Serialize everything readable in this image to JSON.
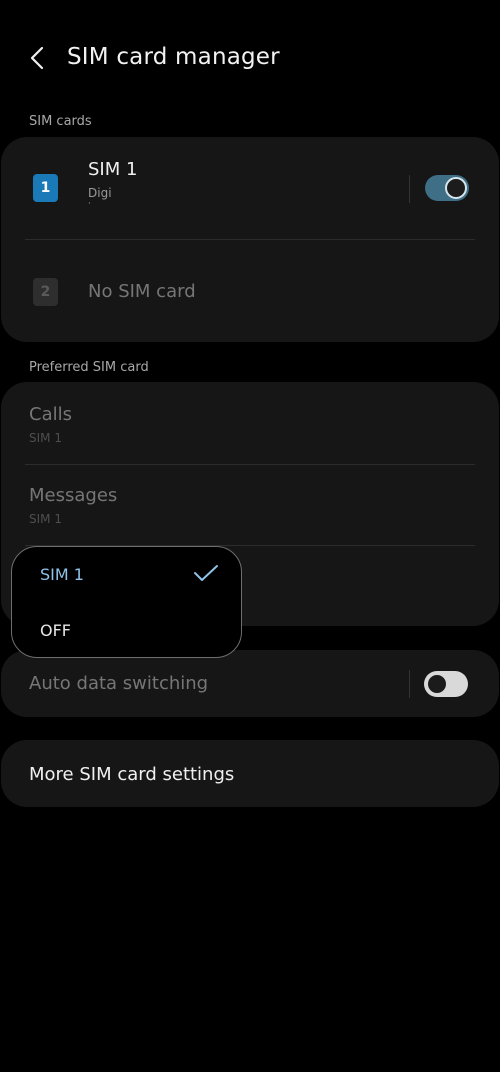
{
  "header": {
    "title": "SIM card manager"
  },
  "sections": {
    "sim_cards_label": "SIM cards",
    "preferred_label": "Preferred SIM card"
  },
  "sim_cards": [
    {
      "badge": "1",
      "name": "SIM 1",
      "carrier": "Digi",
      "carrier_sub": "·",
      "enabled": true
    },
    {
      "badge": "2",
      "name": "No SIM card"
    }
  ],
  "preferred": {
    "calls": {
      "label": "Calls",
      "value": "SIM 1"
    },
    "messages": {
      "label": "Messages",
      "value": "SIM 1"
    }
  },
  "popup": {
    "options": [
      "SIM 1",
      "OFF"
    ],
    "selected": "SIM 1"
  },
  "auto_data_switching": {
    "label": "Auto data switching",
    "enabled": false
  },
  "more_settings": {
    "label": "More SIM card settings"
  },
  "colors": {
    "accent": "#1a7ab8",
    "selected_text": "#8fc3e8",
    "background": "#000000",
    "card": "#161616"
  }
}
